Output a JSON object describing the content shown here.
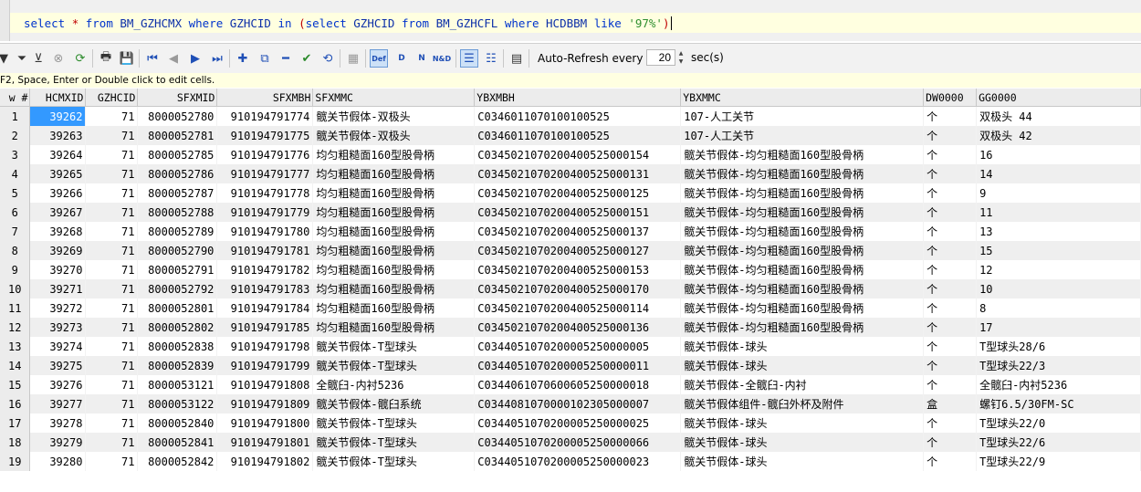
{
  "editor": {
    "sql_parts": [
      {
        "t": "select ",
        "c": "kw"
      },
      {
        "t": "*",
        "c": "op"
      },
      {
        "t": " from ",
        "c": "kw"
      },
      {
        "t": "BM_GZHCMX",
        "c": "id"
      },
      {
        "t": " where ",
        "c": "kw"
      },
      {
        "t": "GZHCID",
        "c": "id"
      },
      {
        "t": " in ",
        "c": "kw"
      },
      {
        "t": "(",
        "c": "op"
      },
      {
        "t": "select ",
        "c": "kw"
      },
      {
        "t": "GZHCID",
        "c": "id"
      },
      {
        "t": " from ",
        "c": "kw"
      },
      {
        "t": "BM_GZHCFL",
        "c": "id"
      },
      {
        "t": " where ",
        "c": "kw"
      },
      {
        "t": "HCDBBM",
        "c": "id"
      },
      {
        "t": " like ",
        "c": "kw"
      },
      {
        "t": "'97%'",
        "c": "str"
      },
      {
        "t": ")",
        "c": "op"
      }
    ]
  },
  "toolbar": {
    "icons": [
      "filter-down-icon",
      "filter-icon",
      "cancel-icon",
      "refresh-icon",
      "print-icon",
      "save-icon",
      "first-record-icon",
      "prev-record-icon",
      "next-record-icon",
      "last-record-icon",
      "insert-record-icon",
      "duplicate-record-icon",
      "delete-record-icon",
      "post-icon",
      "refresh-record-icon",
      "clear-icon",
      "def-icon",
      "d-icon",
      "n-icon",
      "nd-icon",
      "grid-view-icon",
      "form-view-icon",
      "export-icon"
    ],
    "auto_refresh_label": "Auto-Refresh every",
    "interval": "20",
    "secs_label": "sec(s)"
  },
  "hint": "F2, Space, Enter or Double click to edit cells.",
  "grid": {
    "columns": [
      "w #",
      "HCMXID",
      "GZHCID",
      "SFXMID",
      "SFXMBH",
      "SFXMMC",
      "YBXMBH",
      "YBXMMC",
      "DW0000",
      "GG0000"
    ],
    "rows": [
      [
        "1",
        "39262",
        "71",
        "8000052780",
        "910194791774",
        "髋关节假体-双极头",
        "C0346011070100100525",
        "107-人工关节",
        "个",
        "双极头 44"
      ],
      [
        "2",
        "39263",
        "71",
        "8000052781",
        "910194791775",
        "髋关节假体-双极头",
        "C0346011070100100525",
        "107-人工关节",
        "个",
        "双极头 42"
      ],
      [
        "3",
        "39264",
        "71",
        "8000052785",
        "910194791776",
        "均匀粗糙面160型股骨柄",
        "C0345021070200400525000154",
        "髋关节假体-均匀粗糙面160型股骨柄",
        "个",
        "16"
      ],
      [
        "4",
        "39265",
        "71",
        "8000052786",
        "910194791777",
        "均匀粗糙面160型股骨柄",
        "C0345021070200400525000131",
        "髋关节假体-均匀粗糙面160型股骨柄",
        "个",
        "14"
      ],
      [
        "5",
        "39266",
        "71",
        "8000052787",
        "910194791778",
        "均匀粗糙面160型股骨柄",
        "C0345021070200400525000125",
        "髋关节假体-均匀粗糙面160型股骨柄",
        "个",
        "9"
      ],
      [
        "6",
        "39267",
        "71",
        "8000052788",
        "910194791779",
        "均匀粗糙面160型股骨柄",
        "C0345021070200400525000151",
        "髋关节假体-均匀粗糙面160型股骨柄",
        "个",
        "11"
      ],
      [
        "7",
        "39268",
        "71",
        "8000052789",
        "910194791780",
        "均匀粗糙面160型股骨柄",
        "C0345021070200400525000137",
        "髋关节假体-均匀粗糙面160型股骨柄",
        "个",
        "13"
      ],
      [
        "8",
        "39269",
        "71",
        "8000052790",
        "910194791781",
        "均匀粗糙面160型股骨柄",
        "C0345021070200400525000127",
        "髋关节假体-均匀粗糙面160型股骨柄",
        "个",
        "15"
      ],
      [
        "9",
        "39270",
        "71",
        "8000052791",
        "910194791782",
        "均匀粗糙面160型股骨柄",
        "C0345021070200400525000153",
        "髋关节假体-均匀粗糙面160型股骨柄",
        "个",
        "12"
      ],
      [
        "10",
        "39271",
        "71",
        "8000052792",
        "910194791783",
        "均匀粗糙面160型股骨柄",
        "C0345021070200400525000170",
        "髋关节假体-均匀粗糙面160型股骨柄",
        "个",
        "10"
      ],
      [
        "11",
        "39272",
        "71",
        "8000052801",
        "910194791784",
        "均匀粗糙面160型股骨柄",
        "C0345021070200400525000114",
        "髋关节假体-均匀粗糙面160型股骨柄",
        "个",
        "8"
      ],
      [
        "12",
        "39273",
        "71",
        "8000052802",
        "910194791785",
        "均匀粗糙面160型股骨柄",
        "C0345021070200400525000136",
        "髋关节假体-均匀粗糙面160型股骨柄",
        "个",
        "17"
      ],
      [
        "13",
        "39274",
        "71",
        "8000052838",
        "910194791798",
        "髋关节假体-T型球头",
        "C0344051070200005250000005",
        "髋关节假体-球头",
        "个",
        "T型球头28/6"
      ],
      [
        "14",
        "39275",
        "71",
        "8000052839",
        "910194791799",
        "髋关节假体-T型球头",
        "C0344051070200005250000011",
        "髋关节假体-球头",
        "个",
        "T型球头22/3"
      ],
      [
        "15",
        "39276",
        "71",
        "8000053121",
        "910194791808",
        "全髋臼-内衬5236",
        "C0344061070600605250000018",
        "髋关节假体-全髋臼-内衬",
        "个",
        "全髋臼-内衬5236"
      ],
      [
        "16",
        "39277",
        "71",
        "8000053122",
        "910194791809",
        "髋关节假体-髋臼系统",
        "C0344081070000102305000007",
        "髋关节假体组件-髋臼外杯及附件",
        "盒",
        "螺钉6.5/30FM-SC"
      ],
      [
        "17",
        "39278",
        "71",
        "8000052840",
        "910194791800",
        "髋关节假体-T型球头",
        "C0344051070200005250000025",
        "髋关节假体-球头",
        "个",
        "T型球头22/0"
      ],
      [
        "18",
        "39279",
        "71",
        "8000052841",
        "910194791801",
        "髋关节假体-T型球头",
        "C0344051070200005250000066",
        "髋关节假体-球头",
        "个",
        "T型球头22/6"
      ],
      [
        "19",
        "39280",
        "71",
        "8000052842",
        "910194791802",
        "髋关节假体-T型球头",
        "C0344051070200005250000023",
        "髋关节假体-球头",
        "个",
        "T型球头22/9"
      ]
    ]
  }
}
